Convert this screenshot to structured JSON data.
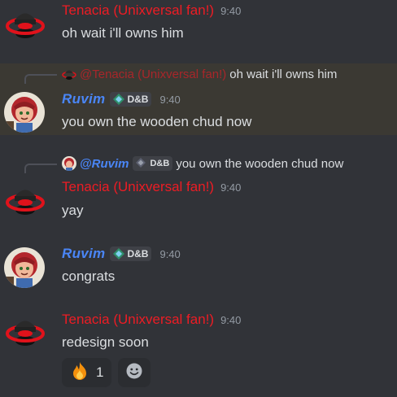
{
  "users": {
    "tenacia": {
      "name": "Tenacia (Unixversal fan!)",
      "mention": "@Tenacia (Unixversal fan!)"
    },
    "ruvim": {
      "name": "Ruvim",
      "mention": "@Ruvim",
      "tag": "D&B"
    }
  },
  "messages": [
    {
      "time": "9:40",
      "text": "oh wait i'll owns him"
    },
    {
      "reply_text": "oh wait i'll owns him",
      "time": "9:40",
      "text": "you own the wooden chud now"
    },
    {
      "reply_text": "you own the wooden chud now",
      "time": "9:40",
      "text": "yay"
    },
    {
      "time": "9:40",
      "text": "congrats"
    },
    {
      "time": "9:40",
      "text": "redesign soon"
    }
  ],
  "reaction": {
    "emoji": "fire-emoji",
    "count": "1"
  },
  "colors": {
    "tenacia": "#ed1c24",
    "ruvim": "#4a86f7",
    "background": "#313338",
    "highlight": "#3b3933"
  }
}
